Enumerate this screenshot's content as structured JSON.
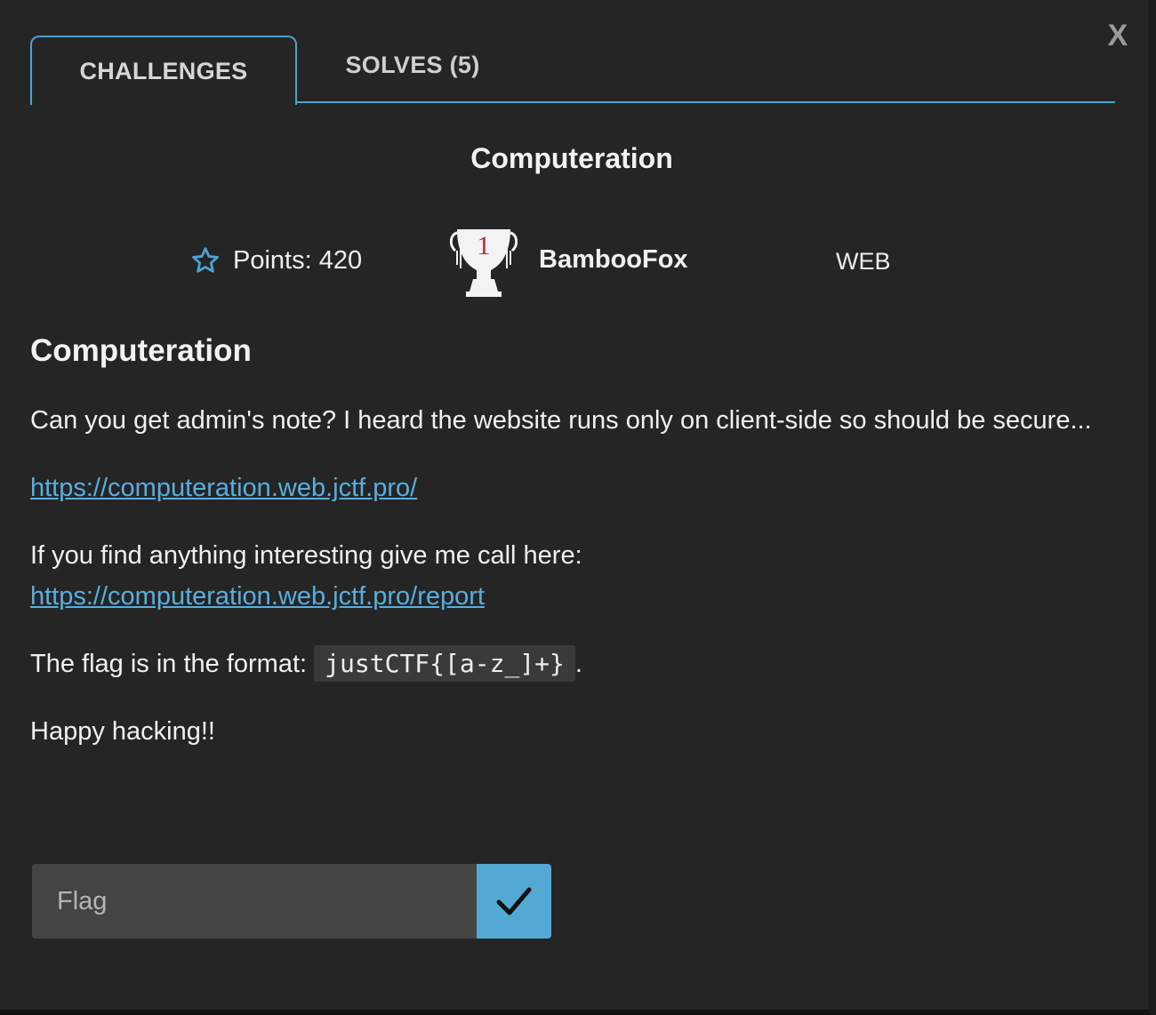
{
  "modal": {
    "close_label": "X"
  },
  "tabs": [
    {
      "label": "CHALLENGES",
      "active": true
    },
    {
      "label": "SOLVES (5)",
      "active": false
    }
  ],
  "challenge": {
    "title": "Computeration",
    "points": "Points: 420",
    "author": "BambooFox",
    "trophy_rank": "1",
    "category": "WEB"
  },
  "description": {
    "heading": "Computeration",
    "intro": "Can you get admin's note? I heard the website runs only on client-side so should be secure...",
    "link1": "https://computeration.web.jctf.pro/",
    "report_text": "If you find anything interesting give me call here:",
    "link2": "https://computeration.web.jctf.pro/report",
    "format_prefix": "The flag is in the format: ",
    "format_code": "justCTF{[a-z_]+}",
    "format_suffix": ".",
    "outro": "Happy hacking!!"
  },
  "form": {
    "flag_placeholder": "Flag",
    "flag_value": ""
  },
  "icons": {
    "points": "star-outline-icon",
    "submit": "checkmark-icon",
    "trophy": "trophy-icon"
  },
  "colors": {
    "accent": "#4ea3cf",
    "link": "#58aede",
    "submit_bg": "#54a8d4",
    "background": "#252525"
  }
}
